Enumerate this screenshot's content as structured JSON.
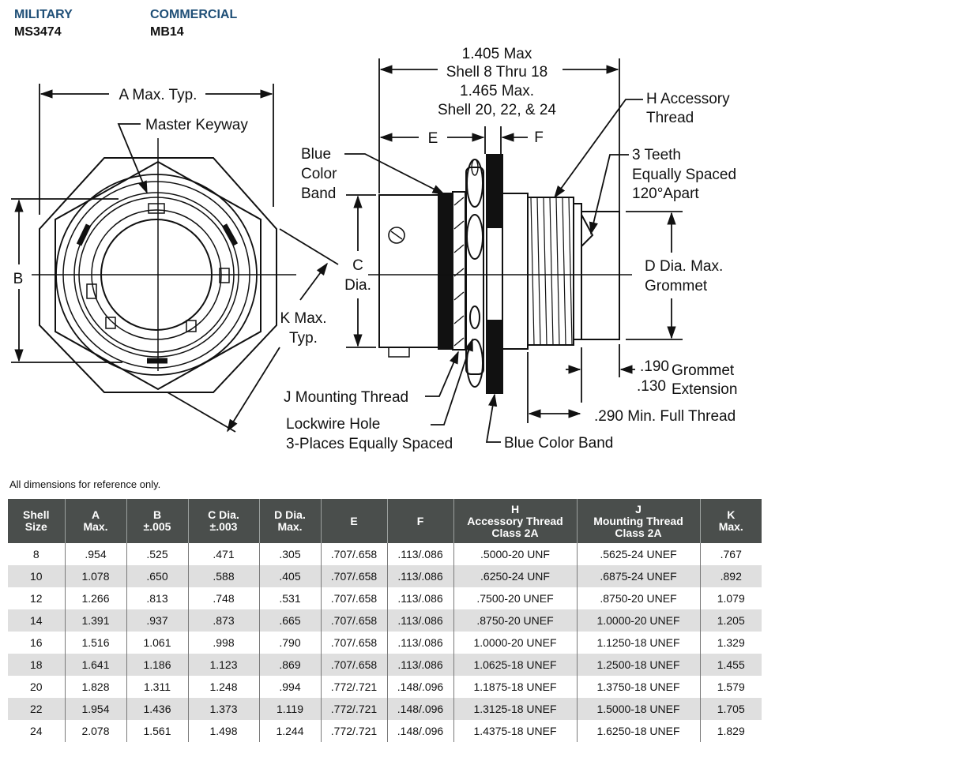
{
  "header": {
    "military_label": "MILITARY",
    "military_code": "MS3474",
    "commercial_label": "COMMERCIAL",
    "commercial_code": "MB14"
  },
  "drawing": {
    "labels": {
      "a_max": "A Max. Typ.",
      "master_keyway": "Master Keyway",
      "b": "B",
      "k_max_1": "K Max.",
      "k_max_2": "Typ.",
      "overall_1": "1.405 Max",
      "overall_2": "Shell 8 Thru 18",
      "overall_3": "1.465 Max.",
      "overall_4": "Shell 20, 22, & 24",
      "e": "E",
      "f": "F",
      "blue_band_1": "Blue",
      "blue_band_2": "Color",
      "blue_band_3": "Band",
      "c_dia_1": "C",
      "c_dia_2": "Dia.",
      "h_accessory_1": "H Accessory",
      "h_accessory_2": "Thread",
      "teeth_1": "3 Teeth",
      "teeth_2": "Equally Spaced",
      "teeth_3": "120°Apart",
      "d_dia_1": "D Dia. Max.",
      "d_dia_2": "Grommet",
      "grommet_190": ".190",
      "grommet_130": ".130",
      "grommet_ext_1": "Grommet",
      "grommet_ext_2": "Extension",
      "full_thread": ".290 Min. Full Thread",
      "j_mounting": "J Mounting Thread",
      "lockwire_1": "Lockwire Hole",
      "lockwire_2": "3-Places Equally Spaced",
      "blue_band_bottom": "Blue Color Band"
    }
  },
  "note": "All dimensions for reference only.",
  "table": {
    "headers": [
      [
        "Shell",
        "Size"
      ],
      [
        "A",
        "Max."
      ],
      [
        "B",
        "±.005"
      ],
      [
        "C Dia.",
        "±.003"
      ],
      [
        "D Dia.",
        "Max."
      ],
      [
        "E"
      ],
      [
        "F"
      ],
      [
        "H",
        "Accessory Thread",
        "Class 2A"
      ],
      [
        "J",
        "Mounting Thread",
        "Class 2A"
      ],
      [
        "K",
        "Max."
      ]
    ],
    "rows": [
      [
        "8",
        ".954",
        ".525",
        ".471",
        ".305",
        ".707/.658",
        ".113/.086",
        ".5000-20 UNF",
        ".5625-24 UNEF",
        ".767"
      ],
      [
        "10",
        "1.078",
        ".650",
        ".588",
        ".405",
        ".707/.658",
        ".113/.086",
        ".6250-24 UNF",
        ".6875-24 UNEF",
        ".892"
      ],
      [
        "12",
        "1.266",
        ".813",
        ".748",
        ".531",
        ".707/.658",
        ".113/.086",
        ".7500-20 UNEF",
        ".8750-20 UNEF",
        "1.079"
      ],
      [
        "14",
        "1.391",
        ".937",
        ".873",
        ".665",
        ".707/.658",
        ".113/.086",
        ".8750-20 UNEF",
        "1.0000-20 UNEF",
        "1.205"
      ],
      [
        "16",
        "1.516",
        "1.061",
        ".998",
        ".790",
        ".707/.658",
        ".113/.086",
        "1.0000-20 UNEF",
        "1.1250-18 UNEF",
        "1.329"
      ],
      [
        "18",
        "1.641",
        "1.186",
        "1.123",
        ".869",
        ".707/.658",
        ".113/.086",
        "1.0625-18 UNEF",
        "1.2500-18 UNEF",
        "1.455"
      ],
      [
        "20",
        "1.828",
        "1.311",
        "1.248",
        ".994",
        ".772/.721",
        ".148/.096",
        "1.1875-18 UNEF",
        "1.3750-18 UNEF",
        "1.579"
      ],
      [
        "22",
        "1.954",
        "1.436",
        "1.373",
        "1.119",
        ".772/.721",
        ".148/.096",
        "1.3125-18 UNEF",
        "1.5000-18 UNEF",
        "1.705"
      ],
      [
        "24",
        "2.078",
        "1.561",
        "1.498",
        "1.244",
        ".772/.721",
        ".148/.096",
        "1.4375-18 UNEF",
        "1.6250-18 UNEF",
        "1.829"
      ]
    ]
  }
}
